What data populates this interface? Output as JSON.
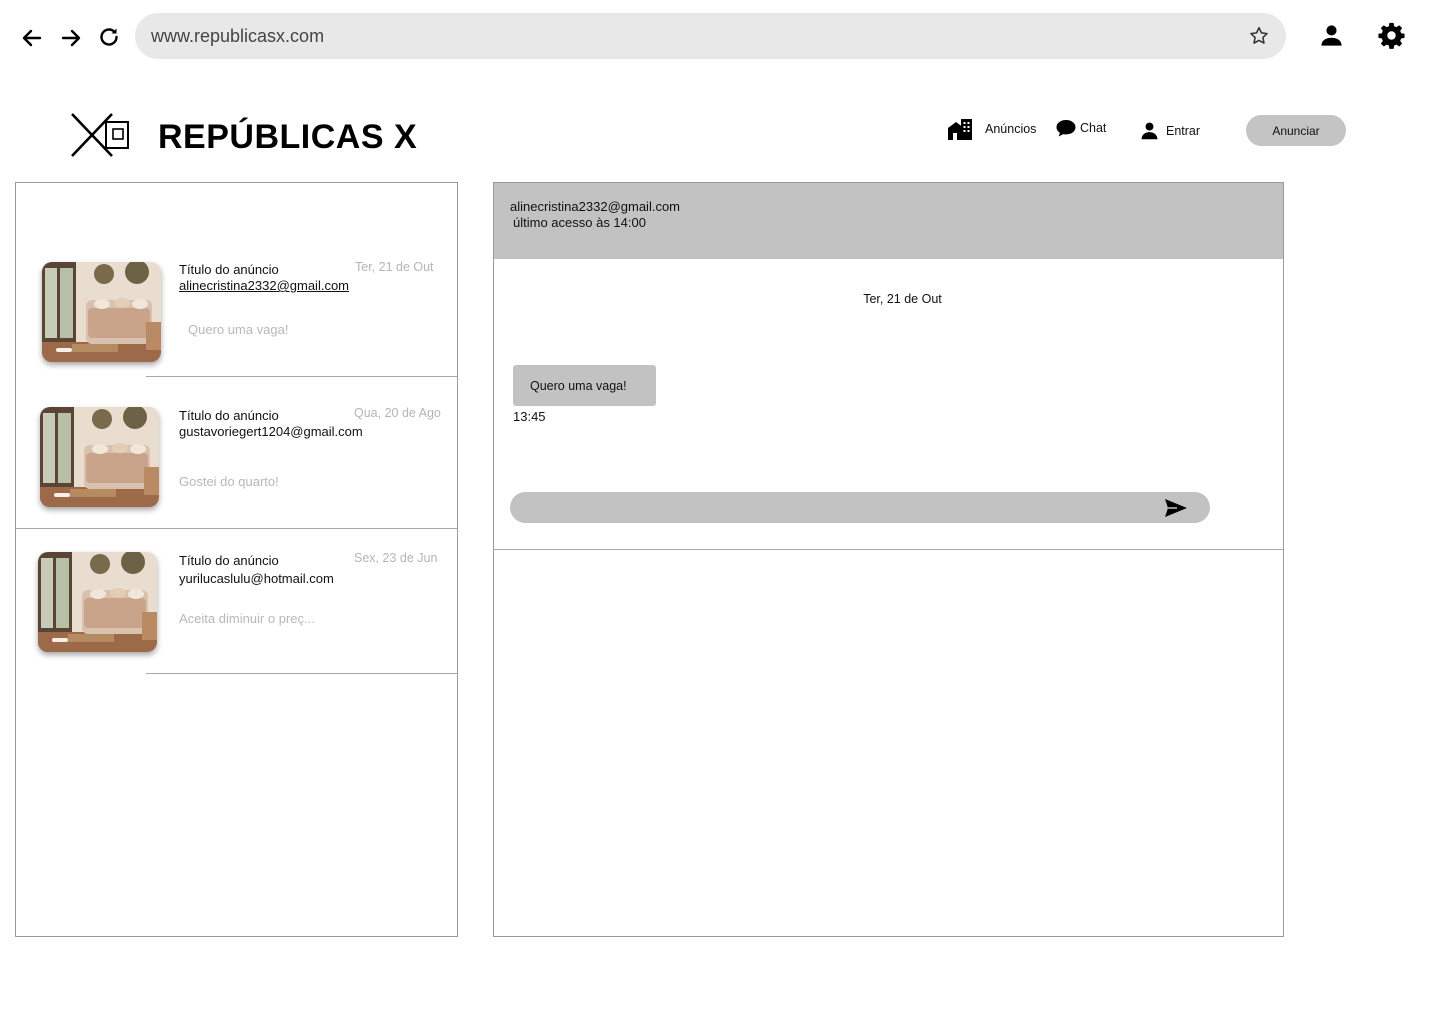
{
  "browser": {
    "url": "www.republicasx.com",
    "icons": [
      "back-arrow-icon",
      "forward-arrow-icon",
      "reload-icon",
      "star-icon",
      "profile-icon",
      "gear-icon"
    ]
  },
  "header": {
    "brand": "REPÚBLICAS X",
    "nav": {
      "anuncios": "Anúncios",
      "chat": "Chat",
      "entrar": "Entrar",
      "anunciar": "Anunciar"
    }
  },
  "conversations": [
    {
      "title": "Título do anúncio",
      "email": "alinecristina2332@gmail.com",
      "date": "Ter, 21 de Out",
      "preview": "Quero uma vaga!",
      "selected": true
    },
    {
      "title": "Título do anúncio",
      "email": "gustavoriegert1204@gmail.com",
      "date": "Qua, 20 de Ago",
      "preview": "Gostei do quarto!",
      "selected": false
    },
    {
      "title": "Título do anúncio",
      "email": "yurilucaslulu@hotmail.com",
      "date": "Sex, 23 de Jun",
      "preview": "Aceita diminuir o preç...",
      "selected": false
    }
  ],
  "chat": {
    "contact_email": "alinecristina2332@gmail.com",
    "last_seen": "último acesso às 14:00",
    "day": "Ter, 21 de Out",
    "messages": [
      {
        "text": "Quero uma vaga!",
        "time": "13:45"
      }
    ],
    "input_placeholder": ""
  },
  "colors": {
    "panel_gray": "#c2c2c2",
    "urlbar_bg": "#e8e8e8",
    "muted_text": "#b5b5b5",
    "border": "#9a9a9a"
  }
}
